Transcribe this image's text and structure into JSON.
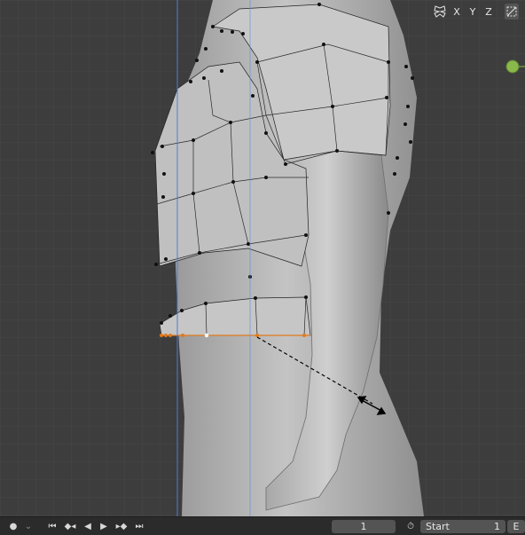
{
  "header": {
    "axis_x": "X",
    "axis_y": "Y",
    "axis_z": "Z",
    "mirror_icon": "butterfly-mirror-icon",
    "snap_icon": "wireframe-toggle-icon"
  },
  "gizmo": {
    "icon": "view-gizmo-handle-icon",
    "color": "#8ab84a"
  },
  "timeline": {
    "current_frame": "1",
    "start_label": "Start",
    "start_value": "1",
    "end_label_partial": "E"
  },
  "colors": {
    "viewport_bg": "#3d3d3d",
    "grid": "#474747",
    "selected_edge": "#e07a1c",
    "axis_line": "#4f7bd6",
    "mesh": "#b9b9b9"
  }
}
